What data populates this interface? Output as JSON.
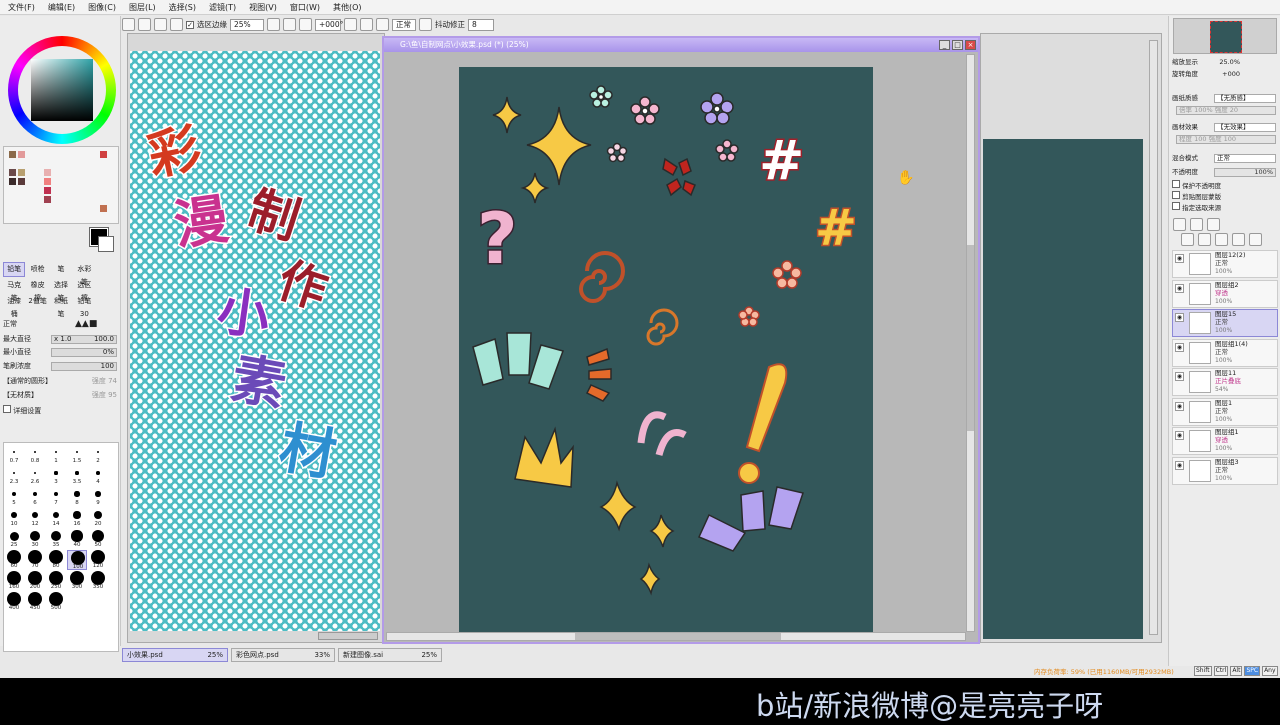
{
  "menu": [
    "文件(F)",
    "编辑(E)",
    "图像(C)",
    "图层(L)",
    "选择(S)",
    "滤镜(T)",
    "视图(V)",
    "窗口(W)",
    "其他(O)"
  ],
  "toolbar": {
    "antialias_label": "选区边缘",
    "zoom": "25%",
    "rotation": "+000°",
    "blend": "正常",
    "stabilizer_label": "抖动修正",
    "stabilizer_value": "8"
  },
  "brush_tools": [
    "铅笔",
    "喷枪",
    "笔",
    "水彩笔",
    "",
    "马克笔",
    "橡皮擦",
    "选择笔",
    "选区擦",
    "",
    "油漆桶",
    "2值笔",
    "和纸笔",
    "铅笔30",
    ""
  ],
  "brush_options": {
    "mode": "正常",
    "max_diameter_label": "最大直径",
    "max_diameter_mult": "x 1.0",
    "max_diameter": "100.0",
    "min_diameter_label": "最小直径",
    "min_diameter": "0%",
    "density_label": "笔刷浓度",
    "density": "100",
    "shape": "【通常的圆形】",
    "shape_strength": "强度 74",
    "texture": "【无材质】",
    "texture_strength": "强度 95",
    "details_label": "详细设置"
  },
  "dot_sizes": [
    "0.7",
    "0.8",
    "1",
    "1.5",
    "2",
    "2.3",
    "2.6",
    "3",
    "3.5",
    "4",
    "5",
    "6",
    "7",
    "8",
    "9",
    "10",
    "12",
    "14",
    "16",
    "20",
    "25",
    "30",
    "35",
    "40",
    "50",
    "60",
    "70",
    "80",
    "100",
    "120",
    "160",
    "200",
    "250",
    "300",
    "350",
    "400",
    "450",
    "500"
  ],
  "main_window": {
    "title": "G:\\鱼\\自制网点\\小效果.psd (*) (25%)"
  },
  "left_artwork_text": [
    "彩",
    "漫",
    "制",
    "作",
    "小",
    "素",
    "材"
  ],
  "right_panel": {
    "zoom_label": "缩放显示",
    "zoom": "25.0%",
    "rotate_label": "旋转角度",
    "rotate": "+000",
    "paper_label": "画纸质感",
    "paper": "【无质感】",
    "paper_scale": "倍率 100%",
    "paper_strength": "强度 20",
    "material_label": "画材效果",
    "material": "【无效果】",
    "material_scale": "程度 100",
    "material_width": "强度 100",
    "blend_label": "混合模式",
    "blend": "正常",
    "opacity_label": "不透明度",
    "opacity": "100%",
    "protect": "保护不透明度",
    "clip": "剪贴图层蒙版",
    "selection_source": "指定选取来源"
  },
  "layers": [
    {
      "name": "图层12(2)",
      "mode": "正常",
      "opacity": "100%",
      "pink": false,
      "sel": false
    },
    {
      "name": "图层组2",
      "mode": "穿透",
      "opacity": "100%",
      "pink": true,
      "sel": false
    },
    {
      "name": "图层15",
      "mode": "正常",
      "opacity": "100%",
      "pink": false,
      "sel": true
    },
    {
      "name": "图层组1(4)",
      "mode": "正常",
      "opacity": "100%",
      "pink": false,
      "sel": false
    },
    {
      "name": "图层11",
      "mode": "正片叠底",
      "opacity": "54%",
      "pink": true,
      "sel": false
    },
    {
      "name": "图层1",
      "mode": "正常",
      "opacity": "100%",
      "pink": false,
      "sel": false
    },
    {
      "name": "图层组1",
      "mode": "穿透",
      "opacity": "100%",
      "pink": true,
      "sel": false
    },
    {
      "name": "图层组3",
      "mode": "正常",
      "opacity": "100%",
      "pink": false,
      "sel": false
    }
  ],
  "doc_tabs": [
    {
      "name": "小效果.psd",
      "zoom": "25%",
      "sel": true
    },
    {
      "name": "彩色网点.psd",
      "zoom": "33%",
      "sel": false
    },
    {
      "name": "新建图像.sai",
      "zoom": "25%",
      "sel": false
    }
  ],
  "status": {
    "memory": "内存负荷率: 59% (已用1160MB/可用2932MB)",
    "keys": [
      "Shift",
      "Ctrl",
      "Alt",
      "SPC",
      "Any"
    ]
  },
  "watermark": "b站/新浪微博@是亮亮子呀",
  "colors": {
    "accent": "#a894ea",
    "canvas": "#33575a",
    "cyan": "#4ebdc4"
  }
}
